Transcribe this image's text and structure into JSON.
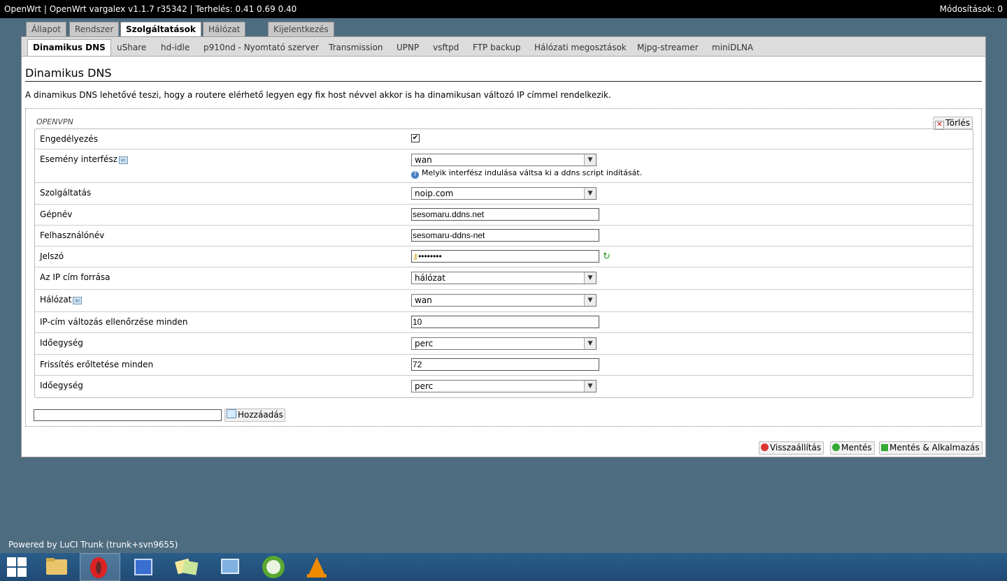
{
  "header": {
    "title": "OpenWrt | OpenWrt vargalex v1.1.7 r35342 | Terhelés: 0.41 0.69 0.40",
    "changes": "Módosítások: 0"
  },
  "main_tabs": [
    "Állapot",
    "Rendszer",
    "Szolgáltatások",
    "Hálózat",
    "Kijelentkezés"
  ],
  "active_main_tab": "Szolgáltatások",
  "sub_tabs": [
    "Dinamikus DNS",
    "uShare",
    "hd-idle",
    "p910nd - Nyomtató szerver",
    "Transmission",
    "UPNP",
    "vsftpd",
    "FTP backup",
    "Hálózati megosztások",
    "Mjpg-streamer",
    "miniDLNA"
  ],
  "active_sub_tab": "Dinamikus DNS",
  "page": {
    "title": "Dinamikus DNS",
    "description": "A dinamikus DNS lehetővé teszi, hogy a routere elérhető legyen egy fix host névvel akkor is ha dinamikusan változó IP címmel rendelkezik."
  },
  "section": {
    "legend": "OPENVPN",
    "delete_label": "Törlés"
  },
  "fields": {
    "enable": {
      "label": "Engedélyezés",
      "checked": true,
      "mark": "✔"
    },
    "event_interface": {
      "label": "Esemény interfész",
      "value": "wan",
      "hint": "Melyik interfész indulása váltsa ki a ddns script indítását."
    },
    "service": {
      "label": "Szolgáltatás",
      "value": "noip.com"
    },
    "hostname": {
      "label": "Gépnév",
      "value": "sesomaru.ddns.net"
    },
    "username": {
      "label": "Felhasználónév",
      "value": "sesomaru-ddns-net"
    },
    "password": {
      "label": "Jelszó",
      "value": "••••••••"
    },
    "ip_source": {
      "label": "Az IP cím forrása",
      "value": "hálózat"
    },
    "network": {
      "label": "Hálózat",
      "value": "wan"
    },
    "check_interval": {
      "label": "IP-cím változás ellenőrzése minden",
      "value": "10"
    },
    "check_unit": {
      "label": "Időegység",
      "value": "perc"
    },
    "force_interval": {
      "label": "Frissítés erőltetése minden",
      "value": "72"
    },
    "force_unit": {
      "label": "Időegység",
      "value": "perc"
    }
  },
  "add_label": "Hozzáadás",
  "actions": {
    "reset": "Visszaállítás",
    "save": "Mentés",
    "save_apply": "Mentés & Alkalmazás"
  },
  "footer": "Powered by LuCI Trunk (trunk+svn9655)",
  "taskbar_icons": [
    "windows-start-icon",
    "file-explorer-icon",
    "opera-icon",
    "network-app-icon",
    "sticky-notes-icon",
    "control-panel-icon",
    "utorrent-icon",
    "vlc-icon"
  ]
}
